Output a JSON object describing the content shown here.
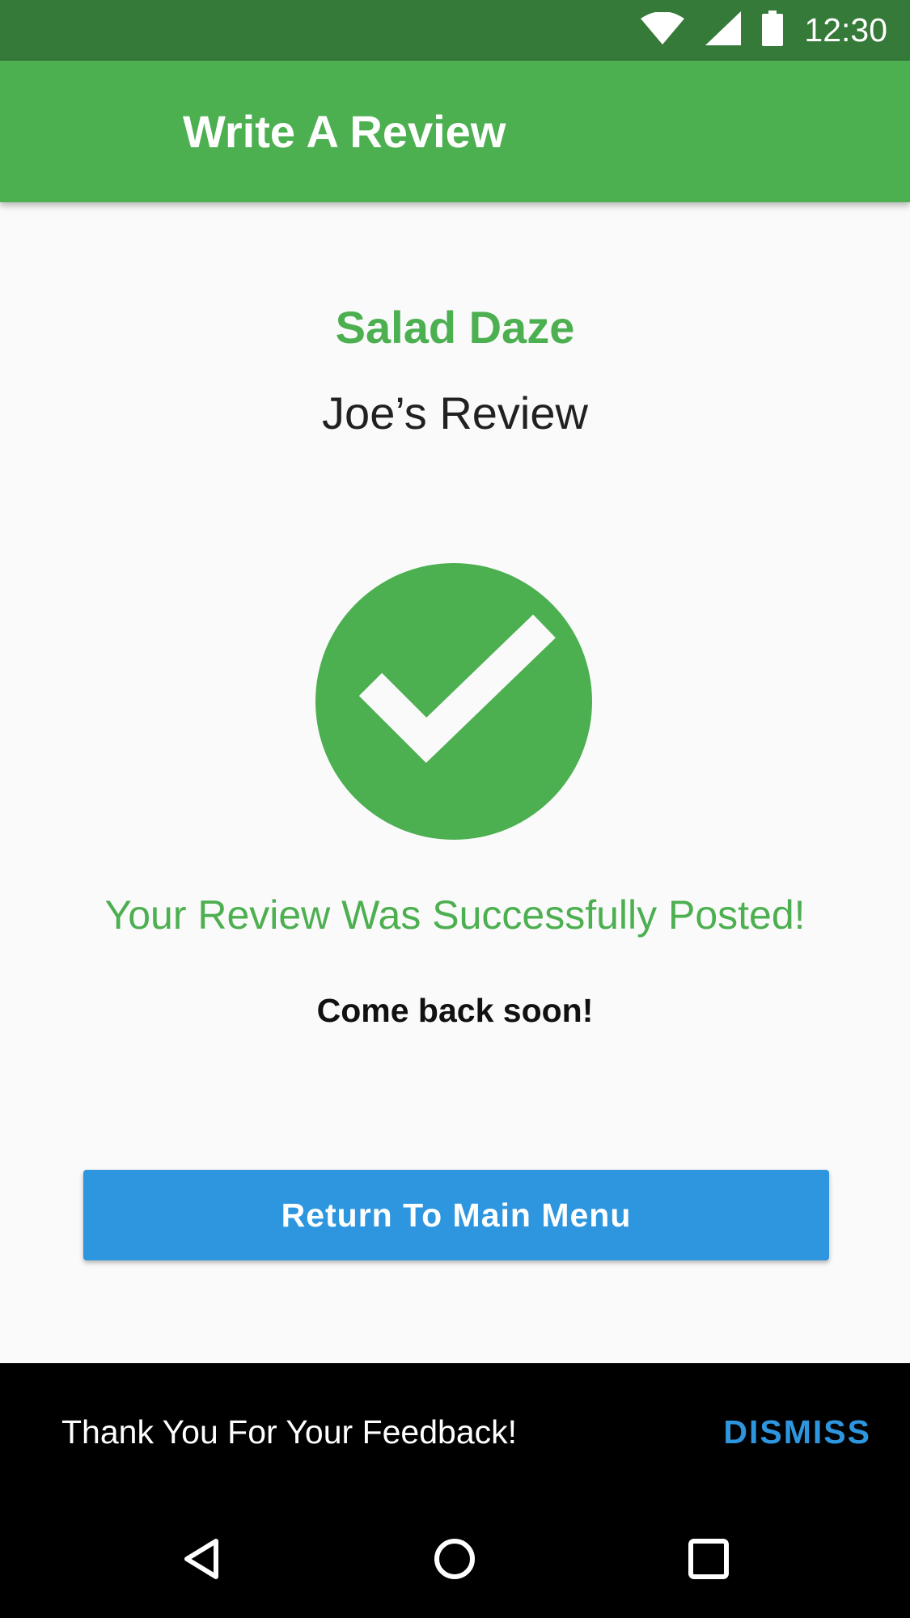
{
  "status_bar": {
    "time": "12:30",
    "icons": [
      "wifi-icon",
      "cell-signal-icon",
      "battery-icon"
    ]
  },
  "app_bar": {
    "title": "Write A Review"
  },
  "content": {
    "restaurant_name": "Salad Daze",
    "review_title": "Joe’s Review",
    "success_icon": "check-circle-icon",
    "success_message": "Your Review Was Successfully Posted!",
    "sub_message": "Come back soon!",
    "main_button_label": "Return To Main Menu"
  },
  "snackbar": {
    "message": "Thank You For Your Feedback!",
    "action_label": "DISMISS"
  },
  "nav_bar": {
    "icons": [
      "back-icon",
      "home-icon",
      "recents-icon"
    ]
  },
  "colors": {
    "status_bar": "#357a38",
    "primary": "#4caf50",
    "button": "#2d96df",
    "snackbar_action": "#2d96df",
    "background": "#fafafa"
  }
}
